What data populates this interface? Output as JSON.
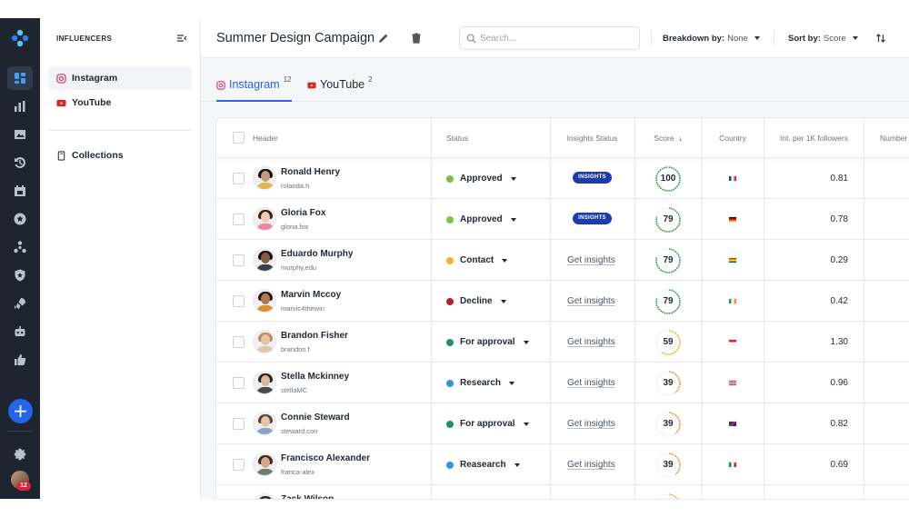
{
  "sidebar": {
    "section_title": "INFLUENCERS",
    "items": [
      {
        "label": "Instagram",
        "active": true
      },
      {
        "label": "YouTube",
        "active": false
      }
    ],
    "collections_label": "Collections"
  },
  "rail": {
    "icons": [
      "dashboard-icon",
      "bar-chart-icon",
      "image-icon",
      "history-icon",
      "calendar-icon",
      "star-icon",
      "network-icon",
      "shield-icon",
      "rocket-icon",
      "robot-icon",
      "thumbs-up-icon"
    ],
    "notification_count": "12"
  },
  "header": {
    "title": "Summer Design Campaign",
    "search_placeholder": "Search...",
    "breakdown_label": "Breakdown by:",
    "breakdown_value": "None",
    "sort_label": "Sort by:",
    "sort_value": "Score"
  },
  "tabs": [
    {
      "label": "Instagram",
      "count": "12",
      "active": true
    },
    {
      "label": "YouTube",
      "count": "2",
      "active": false
    }
  ],
  "table": {
    "columns": [
      "Header",
      "Status",
      "Insights Status",
      "Score",
      "Country",
      "Int. per 1K followers",
      "Number"
    ],
    "insights_pill_label": "INSIGHTS",
    "get_insights_label": "Get insights",
    "rows": [
      {
        "name": "Ronald Henry",
        "handle": "rolanda.h",
        "status": "Approved",
        "status_color": "#7dc243",
        "insights": "pill",
        "score": "100",
        "score_color": "#2e9e3a",
        "flag": "fr",
        "value": "0.81",
        "skin": "#c69c7a",
        "hair": "#1a120d",
        "shirt": "#e6b64a"
      },
      {
        "name": "Gloria Fox",
        "handle": "gloria.fox",
        "status": "Approved",
        "status_color": "#7dc243",
        "insights": "pill",
        "score": "79",
        "score_color": "#2e9e3a",
        "flag": "de",
        "value": "0.78",
        "skin": "#f0cdb5",
        "hair": "#3d2316",
        "shirt": "#e9879a"
      },
      {
        "name": "Eduardo Murphy",
        "handle": "murphy.edu",
        "status": "Contact",
        "status_color": "#f2b324",
        "insights": "link",
        "score": "79",
        "score_color": "#2e9e3a",
        "flag": "bo",
        "value": "0.29",
        "skin": "#8a5c40",
        "hair": "#1a120d",
        "shirt": "#3b3f47"
      },
      {
        "name": "Marvin Mccoy",
        "handle": "marvic4thewin",
        "status": "Decline",
        "status_color": "#b3202c",
        "insights": "link",
        "score": "79",
        "score_color": "#2e9e3a",
        "flag": "ie",
        "value": "0.42",
        "skin": "#b07a55",
        "hair": "#2a1a10",
        "shirt": "#d9902e"
      },
      {
        "name": "Brandon Fisher",
        "handle": "brandon.f",
        "status": "For approval",
        "status_color": "#1f8f73",
        "insights": "link",
        "score": "59",
        "score_color": "#f2b324",
        "flag": "id",
        "value": "1.30",
        "skin": "#e7c3a3",
        "hair": "#b98d5f",
        "shirt": "#dfc9ae"
      },
      {
        "name": "Stella Mckinney",
        "handle": "stellaMC",
        "status": "Research",
        "status_color": "#2f94e0",
        "insights": "link",
        "score": "39",
        "score_color": "#ee8f2f",
        "flag": "us",
        "value": "0.96",
        "skin": "#d9b89c",
        "hair": "#2d2420",
        "shirt": "#4a4a4a"
      },
      {
        "name": "Connie Steward",
        "handle": "steward.con",
        "status": "For approval",
        "status_color": "#1f8f73",
        "insights": "link",
        "score": "39",
        "score_color": "#ee8f2f",
        "flag": "gb",
        "value": "0.82",
        "skin": "#e6c4a8",
        "hair": "#5b4635",
        "shirt": "#8aa4c2"
      },
      {
        "name": "Francisco Alexander",
        "handle": "franca-alex",
        "status": "Reasearch",
        "status_color": "#2f94e0",
        "insights": "link",
        "score": "39",
        "score_color": "#ee8f2f",
        "flag": "it",
        "value": "0.69",
        "skin": "#d4aa88",
        "hair": "#3a2a1f",
        "shirt": "#6f7f66"
      },
      {
        "name": "Zack Wilson",
        "handle": "",
        "status": "",
        "status_color": "#cccccc",
        "insights": "none",
        "score": "",
        "score_color": "#f2b324",
        "flag": "",
        "value": "",
        "skin": "#c9a386",
        "hair": "#2a2a2a",
        "shirt": "#555555"
      }
    ]
  }
}
